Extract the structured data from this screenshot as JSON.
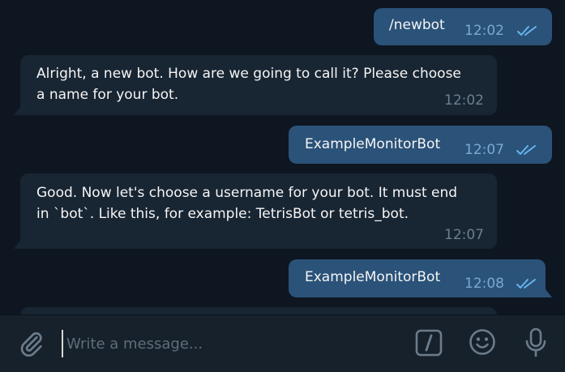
{
  "messages": [
    {
      "direction": "outgoing",
      "text": "/newbot",
      "time": "12:02",
      "read": true
    },
    {
      "direction": "incoming",
      "text": "Alright, a new bot. How are we going to call it? Please choose\na name for your bot.",
      "time": "12:02"
    },
    {
      "direction": "outgoing",
      "text": "ExampleMonitorBot",
      "time": "12:07",
      "read": true
    },
    {
      "direction": "incoming",
      "text": "Good. Now let's choose a username for your bot. It must end\nin `bot`. Like this, for example: TetrisBot or tetris_bot.",
      "time": "12:07"
    },
    {
      "direction": "outgoing",
      "text": "ExampleMonitorBot",
      "time": "12:08",
      "read": true
    }
  ],
  "composer": {
    "placeholder": "Write a message...",
    "icons": [
      "paperclip-icon",
      "bot-commands-icon",
      "emoji-icon",
      "microphone-icon"
    ]
  },
  "colors": {
    "background": "#0e1621",
    "incoming_bubble": "#182533",
    "outgoing_bubble": "#2b5278",
    "composer_bg": "#17212b",
    "read_ticks": "#64b5ef"
  }
}
